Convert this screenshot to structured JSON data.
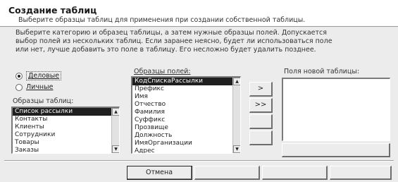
{
  "header": {
    "title": "Создание таблиц",
    "subtitle": "Выберите образцы таблиц для применения при создании собственной таблицы."
  },
  "instructions": {
    "line1": "Выберите категорию и образец таблицы, а затем нужные образцы полей. Допускается",
    "line2": "выбор полей из нескольких таблиц. Если заранее неясно, будет ли использоваться поле",
    "line3": "или нет, лучше добавить это поле в таблицу. Его несложно будет удалить позднее."
  },
  "category": {
    "options": [
      {
        "label": "Деловые",
        "checked": true
      },
      {
        "label": "Личные",
        "checked": false
      }
    ]
  },
  "sample_tables": {
    "label": "Образцы таблиц:",
    "items": [
      "Список рассылки",
      "Контакты",
      "Клиенты",
      "Сотрудники",
      "Товары",
      "Заказы"
    ],
    "selected": "Список рассылки"
  },
  "sample_fields": {
    "label": "Образцы полей:",
    "items": [
      "КодСпискаРассылки",
      "Префикс",
      "Имя",
      "Отчество",
      "Фамилия",
      "Суффикс",
      "Прозвище",
      "Должность",
      "ИмяОрганизации",
      "Адрес"
    ],
    "selected": "КодСпискаРассылки"
  },
  "new_table_fields": {
    "label": "Поля новой таблицы:",
    "items": []
  },
  "move_buttons": {
    "add_one": ">",
    "add_all": ">>",
    "remove_one": "",
    "remove_all": ""
  },
  "rename_button": {
    "label": ""
  },
  "footer": {
    "cancel": "Отмена",
    "back": "",
    "next": "",
    "finish": ""
  }
}
